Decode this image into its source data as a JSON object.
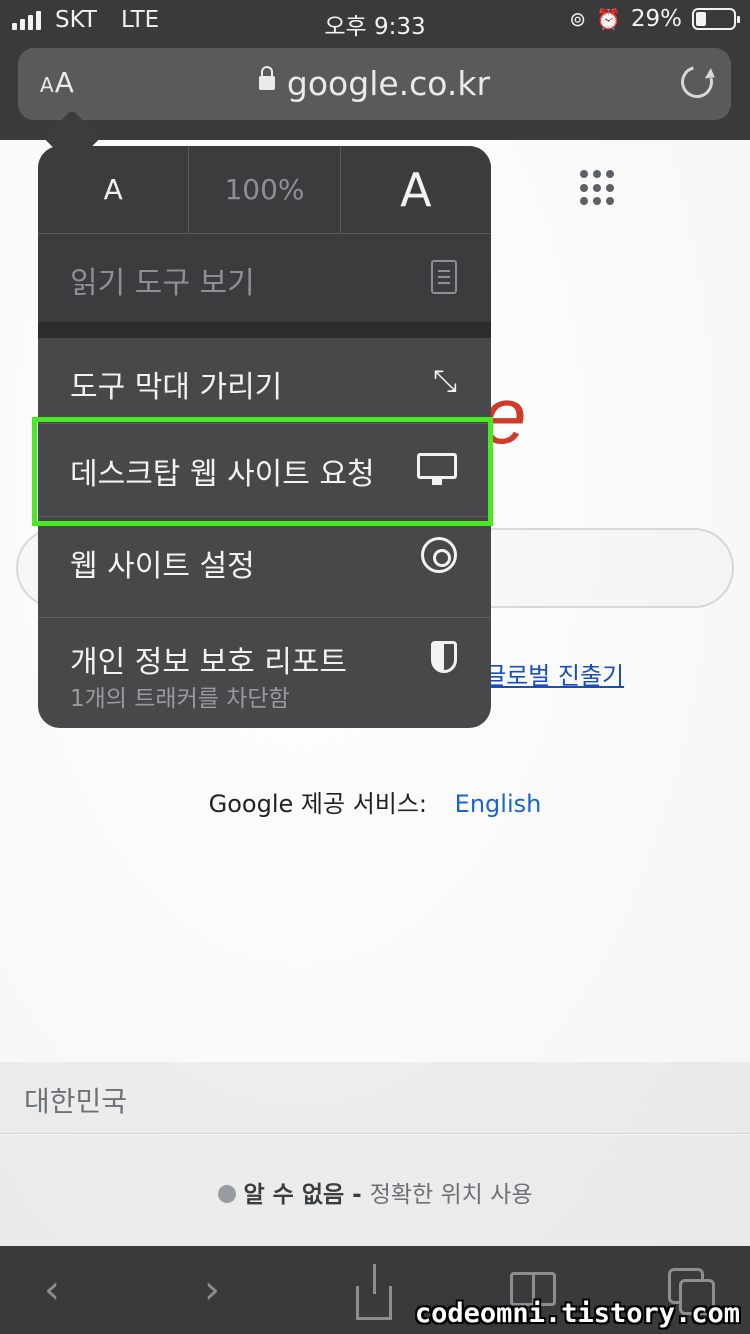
{
  "status": {
    "carrier": "SKT",
    "network": "LTE",
    "time": "오후 9:33",
    "battery": "29%",
    "battery_level": 0.29
  },
  "urlbar": {
    "aa_small": "A",
    "aa_large": "A",
    "url": "google.co.kr"
  },
  "menu": {
    "zoom_small": "A",
    "zoom_pct": "100%",
    "zoom_large": "A",
    "reader": "읽기 도구 보기",
    "hide_toolbar": "도구 막대 가리기",
    "request_desktop": "데스크탑 웹 사이트 요청",
    "website_settings": "웹 사이트 설정",
    "privacy_report": "개인 정보 보호 리포트",
    "privacy_sub": "1개의 트래커를 차단함"
  },
  "page": {
    "logo_fragment": "e",
    "global_link": "글로벌 진출기",
    "offered_in": "Google 제공 서비스:",
    "english": "English",
    "country": "대한민국",
    "location_dot_label": "알 수 없음",
    "location_dash": " - ",
    "location_text": "정확한 위치 사용"
  },
  "bottombar": {
    "back": "‹",
    "forward": "›"
  },
  "watermark": "codeomni.tistory.com",
  "colors": {
    "highlight": "#49ea24",
    "menu_bg": "#48484a",
    "link": "#1a66d2"
  }
}
